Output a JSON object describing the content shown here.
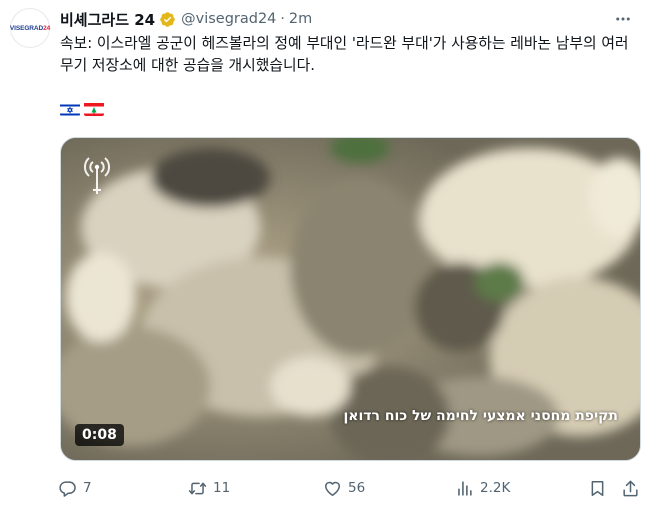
{
  "post": {
    "author_name": "비셰그라드 24",
    "handle": "@visegrad24",
    "separator": "·",
    "time": "2m",
    "avatar_text_main": "VISEGRAD",
    "avatar_text_accent": "24",
    "text": "속보: 이스라엘 공군이 헤즈볼라의 정예 부대인 '라드완 부대'가 사용하는 레바논 남부의 여러 무기 저장소에 대한 공습을 개시했습니다.",
    "flags": [
      "israel-flag",
      "lebanon-flag"
    ]
  },
  "media": {
    "caption": "תקיפת מחסני אמצעי לחימה של כוח רדואן",
    "duration": "0:08"
  },
  "actions": {
    "replies": "7",
    "reposts": "11",
    "likes": "56",
    "views": "2.2K"
  },
  "colors": {
    "text": "#0f1419",
    "secondary": "#536471",
    "verified_gold": "#e2b719",
    "border": "#cfd9de"
  }
}
